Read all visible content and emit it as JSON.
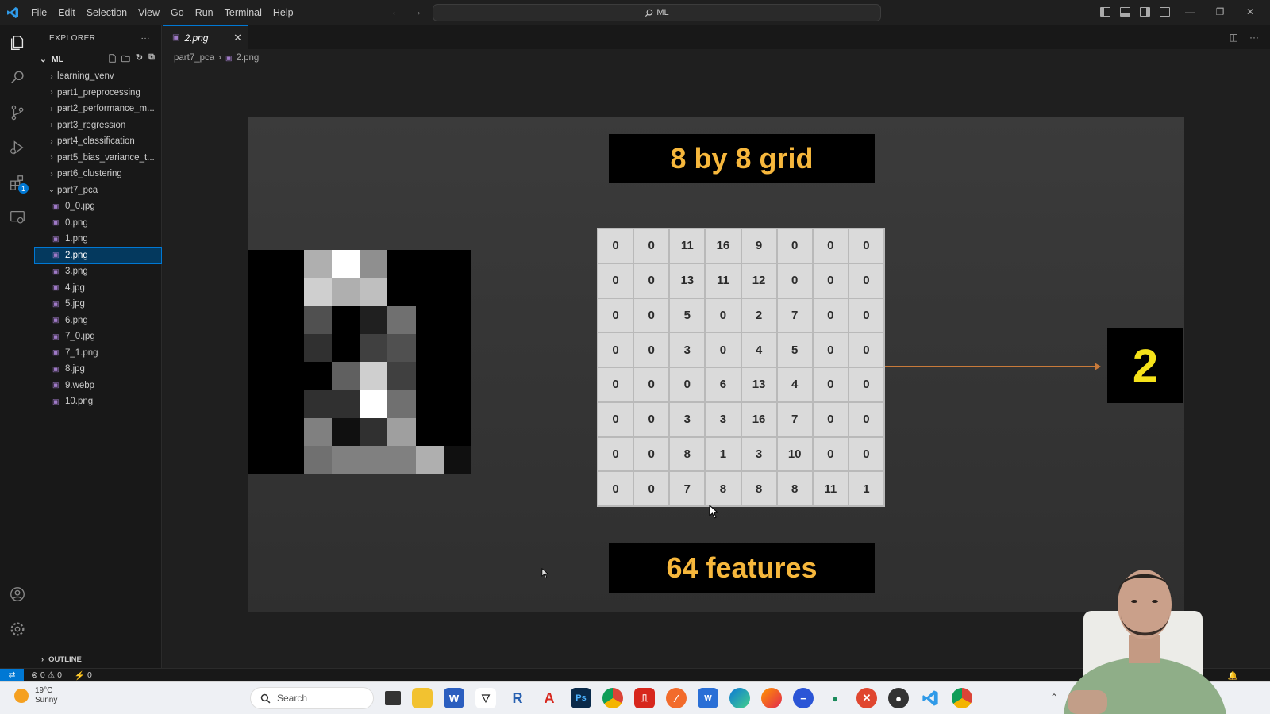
{
  "menu": [
    "File",
    "Edit",
    "Selection",
    "View",
    "Go",
    "Run",
    "Terminal",
    "Help"
  ],
  "search": {
    "text": "ML"
  },
  "explorer": {
    "title": "EXPLORER",
    "root": "ML",
    "folders": [
      "learning_venv",
      "part1_preprocessing",
      "part2_performance_m...",
      "part3_regression",
      "part4_classification",
      "part5_bias_variance_t...",
      "part6_clustering"
    ],
    "open_folder": "part7_pca",
    "files": [
      "0_0.jpg",
      "0.png",
      "1.png",
      "2.png",
      "3.png",
      "4.jpg",
      "5.jpg",
      "6.png",
      "7_0.jpg",
      "7_1.png",
      "8.jpg",
      "9.webp",
      "10.png"
    ],
    "selected": "2.png",
    "outline": "OUTLINE"
  },
  "activity_badge": "1",
  "tab": {
    "label": "2.png"
  },
  "breadcrumb": {
    "folder": "part7_pca",
    "file": "2.png"
  },
  "slide": {
    "title": "8 by 8 grid",
    "features": "64 features",
    "label": "2",
    "grid": [
      [
        0,
        0,
        11,
        16,
        9,
        0,
        0,
        0
      ],
      [
        0,
        0,
        13,
        11,
        12,
        0,
        0,
        0
      ],
      [
        0,
        0,
        5,
        0,
        2,
        7,
        0,
        0
      ],
      [
        0,
        0,
        3,
        0,
        4,
        5,
        0,
        0
      ],
      [
        0,
        0,
        0,
        6,
        13,
        4,
        0,
        0
      ],
      [
        0,
        0,
        3,
        3,
        16,
        7,
        0,
        0
      ],
      [
        0,
        0,
        8,
        1,
        3,
        10,
        0,
        0
      ],
      [
        0,
        0,
        7,
        8,
        8,
        8,
        11,
        1
      ]
    ]
  },
  "status": {
    "errors": "0",
    "warnings": "0",
    "ports": "0"
  },
  "weather": {
    "temp": "19°C",
    "cond": "Sunny"
  },
  "taskbar": {
    "search_placeholder": "Search"
  }
}
